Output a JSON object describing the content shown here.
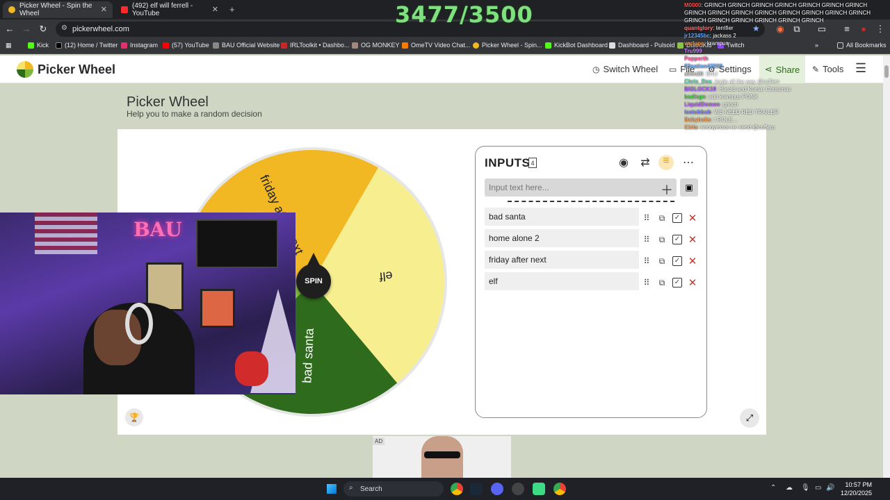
{
  "browser": {
    "tabs": [
      {
        "title": "Picker Wheel - Spin the Wheel"
      },
      {
        "title": "(492) elf will ferrell - YouTube"
      }
    ],
    "url": "pickerwheel.com",
    "bookmarks": [
      "Kick",
      "(12) Home / Twitter",
      "Instagram",
      "(57) YouTube",
      "BAU Official Website",
      "IRLToolkit • Dashbo...",
      "OG MONKEY",
      "OmeTV Video Chat...",
      "Picker Wheel - Spin...",
      "KickBot Dashboard",
      "Dashboard - Pulsoid",
      "DistroKid",
      "Twitch"
    ],
    "all_bookmarks": "All Bookmarks"
  },
  "overlay": {
    "counter": "3477/3500",
    "chat": [
      {
        "user": "M0000",
        "msg": "GRINCH GRINCH GRINCH GRINCH GRINCH GRINCH GRINCH GRINCH GRINCH GRINCH GRINCH GRINCH GRINCH GRINCH GRINCH GRINCH GRINCH GRINCH GRINCH GRINCH GRINCH",
        "color": "#ff4b4b"
      },
      {
        "user": "quantglory",
        "msg": "terrifier",
        "color": "#ff7777"
      },
      {
        "user": "jr12345bc",
        "msg": "jackass 2",
        "color": "#66aaff"
      },
      {
        "user": "varlupe",
        "msg": "krampus",
        "color": "#ff9944"
      },
      {
        "user": "Tru999",
        "msg": "",
        "color": "#cc88ff"
      },
      {
        "user": "Pepperth",
        "msg": "",
        "color": "#ff66aa"
      },
      {
        "user": "83nation42000",
        "msg": "",
        "color": "#66aaff"
      },
      {
        "user": "allen20",
        "msg": "BAU",
        "color": "#cccccc"
      },
      {
        "user": "Chris_Dss",
        "msg": "jingle all the way @cuffem",
        "color": "#55ddaa"
      },
      {
        "user": "BIGLOCK19",
        "msg": "Harold and Kumar Christmas",
        "color": "#aa66ff"
      },
      {
        "user": "badlsgn",
        "msg": "add krampus PONK",
        "color": "#55dd55"
      },
      {
        "user": "LiquidDemon",
        "msg": "grinch",
        "color": "#bb66ff"
      },
      {
        "user": "lostubbub",
        "msg": "WE NEED RED TRAILER",
        "color": "#8888ff"
      },
      {
        "user": "Babybolts",
        "msg": "I ROLE...",
        "color": "#ffaa66"
      },
      {
        "user": "C14a",
        "msg": "anonymous re: send @cuffem",
        "color": "#ffaa66"
      }
    ]
  },
  "site": {
    "brand": "Picker Wheel",
    "nav": {
      "switch_wheel": "Switch Wheel",
      "file": "File",
      "settings": "Settings",
      "share": "Share",
      "tools": "Tools"
    },
    "title": "Picker Wheel",
    "subtitle": "Help you to make a random decision"
  },
  "wheel": {
    "spin_label": "SPIN",
    "segments": [
      {
        "label": "friday after next",
        "color": "#f2b823"
      },
      {
        "label": "elf",
        "color": "#f7ee8f"
      },
      {
        "label": "bad santa",
        "color": "#2f6b1c"
      },
      {
        "label": "home alone 2",
        "color": "#7db83a"
      }
    ]
  },
  "inputs": {
    "title": "INPUTS",
    "count": "4",
    "placeholder": "Input text here...",
    "items": [
      "bad santa",
      "home alone 2",
      "friday after next",
      "elf"
    ]
  },
  "ad": {
    "label": "AD"
  },
  "taskbar": {
    "search": "Search",
    "time": "10:57 PM",
    "date": "12/20/2025"
  }
}
